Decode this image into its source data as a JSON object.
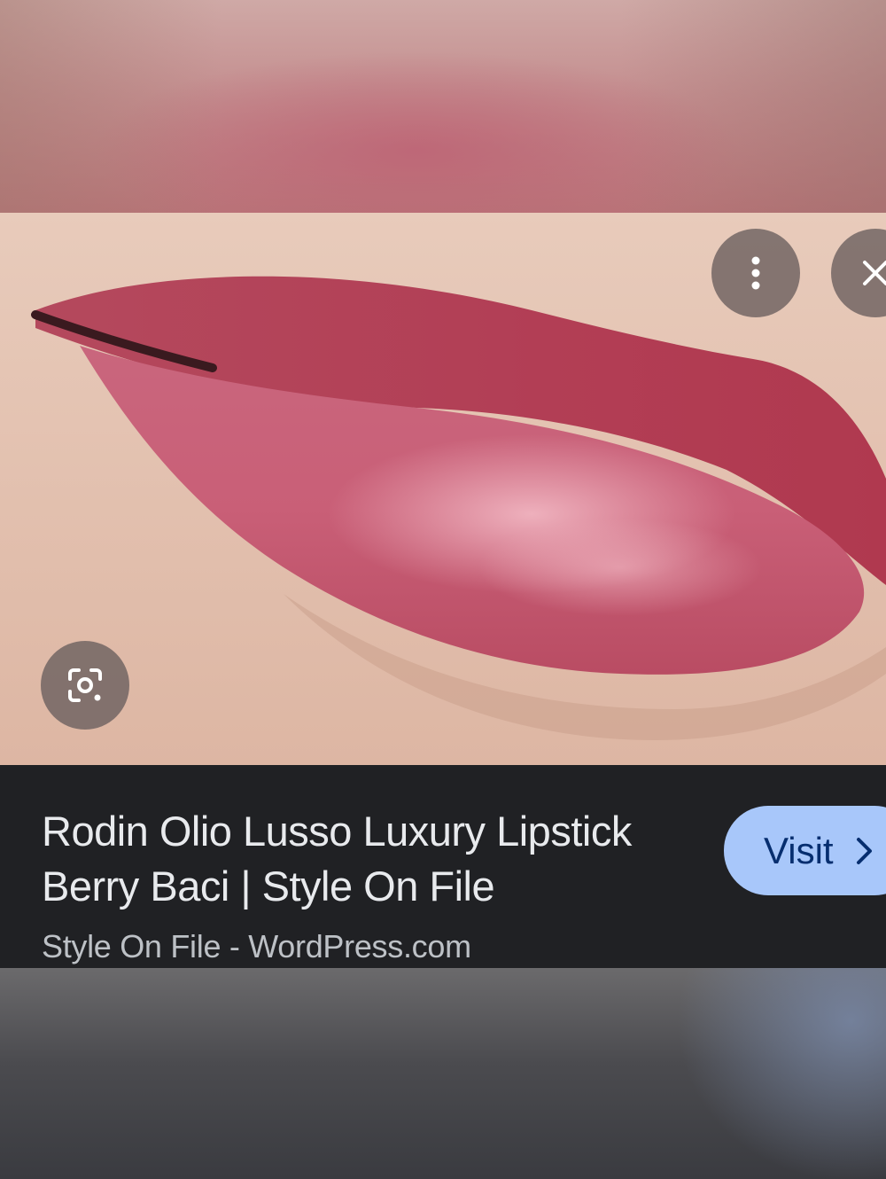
{
  "result": {
    "title_line_1": "Rodin Olio Lusso Luxury Lipstick",
    "title_line_2": "Berry Baci | Style On File",
    "source": "Style On File - WordPress.com",
    "visit_label": "Visit"
  },
  "icons": {
    "more": "more-vert-icon",
    "close": "close-icon",
    "lens": "google-lens-icon",
    "visit": "chevron-right-icon"
  },
  "colors": {
    "panel_background": "#202124",
    "visit_button": "#a8c7fa",
    "visit_text": "#062e6f",
    "title_text": "#e8eaed",
    "source_text": "#bdc1c6",
    "overlay_button": "#6e6260"
  }
}
